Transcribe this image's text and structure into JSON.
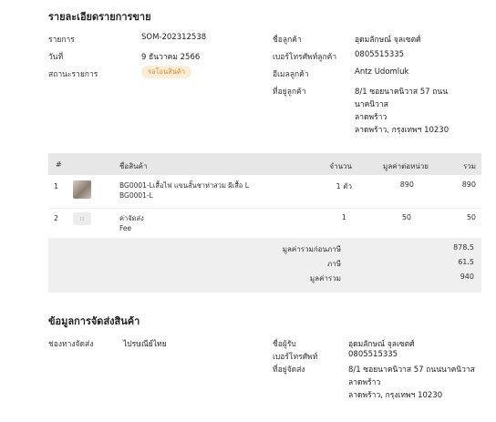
{
  "order": {
    "title": "รายละเอียดรายการขาย",
    "fields": {
      "code_label": "รายการ",
      "code_value": "SOM-202312538",
      "date_label": "วันที่",
      "date_value": "9 ธันวาคม 2566",
      "status_label": "สถานะรายการ",
      "status_value": "รอโอนสินค้า"
    },
    "customer": {
      "name_label": "ชื่อลูกค้า",
      "name_value": "อุดมลักษณ์ จุลเซตศ์",
      "phone_label": "เบอร์โทรศัพท์ลูกค้า",
      "phone_value": "0805515335",
      "email_label": "อีเมลลูกค้า",
      "email_value": "Antz Udomluk",
      "address_label": "ที่อยู่ลูกค้า",
      "address_lines": [
        "8/1 ซอยนาคนิวาส 57 ถนน",
        "นาคนิวาส",
        "ลาดพร้าว",
        "ลาดพร้าว, กรุงเทพฯ 10230"
      ]
    }
  },
  "table": {
    "headers": {
      "num": "#",
      "name": "ชื่อสินค้า",
      "qty": "จำนวน",
      "unit": "มูลค่าต่อหน่วย",
      "total": "รวม"
    },
    "rows": [
      {
        "num": "1",
        "name1": "BG0001-Lเสื้อไฟ แขนสั้นชาห่าสวม ผีเสื้อ L",
        "name2": "BG0001-L",
        "qty": "1 ตัว",
        "unit": "890",
        "total": "890",
        "thumb": "product-photo"
      },
      {
        "num": "2",
        "name1": "ค่าจัดส่ง",
        "name2": "Fee",
        "qty": "1",
        "unit": "50",
        "total": "50",
        "thumb": "image-placeholder-icon"
      }
    ],
    "summary": {
      "before_vat_label": "มูลค่ารวมก่อนภาษี",
      "before_vat_value": "878.5",
      "vat_label": "ภาษี",
      "vat_value": "61.5",
      "grand_label": "มูลค่ารวม",
      "grand_value": "940"
    }
  },
  "shipping": {
    "title": "ข้อมูลการจัดส่งสินค้า",
    "channel_label": "ช่องทางจัดส่ง",
    "channel_value": "ไปรษณีย์ไทย",
    "recipient_label": "ชื่อผู้รับ",
    "recipient_value": "อุดมลักษณ์ จุลเซตศ์",
    "phone_label": "เบอร์โทรศัพท์",
    "phone_value": "0805515335",
    "address_label": "ที่อยู่จัดส่ง",
    "address_lines": [
      "8/1 ซอยนาคนิวาส 57 ถนนนาคนิวาส",
      "ลาดพร้าว",
      "ลาดพร้าว, กรุงเทพฯ 10230"
    ]
  },
  "colors": {
    "badge_bg": "#fdecd8",
    "badge_text": "#e08a2c",
    "table_header": "#e7e7e7",
    "summary_bg": "#efefef"
  }
}
